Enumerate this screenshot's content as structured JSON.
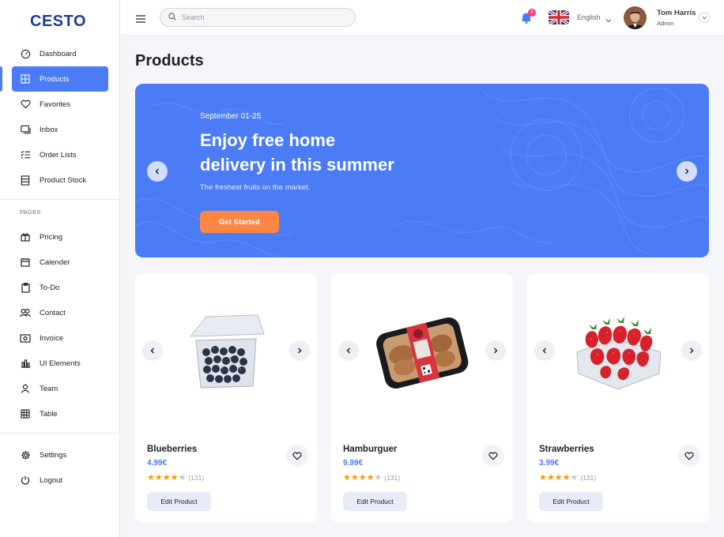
{
  "brand": {
    "logo": "CESTO"
  },
  "sidebar": {
    "items": [
      {
        "label": "Dashboard",
        "icon": "dashboard-icon"
      },
      {
        "label": "Products",
        "icon": "grid-icon",
        "active": true
      },
      {
        "label": "Favorites",
        "icon": "heart-icon"
      },
      {
        "label": "Inbox",
        "icon": "inbox-icon"
      },
      {
        "label": "Order Lists",
        "icon": "list-icon"
      },
      {
        "label": "Product Stock",
        "icon": "stock-icon"
      }
    ],
    "pages_label": "PAGES",
    "pages": [
      {
        "label": "Pricing",
        "icon": "gift-icon"
      },
      {
        "label": "Calender",
        "icon": "calendar-icon"
      },
      {
        "label": "To-Do",
        "icon": "clipboard-icon"
      },
      {
        "label": "Contact",
        "icon": "users-icon"
      },
      {
        "label": "Invoice",
        "icon": "invoice-icon"
      },
      {
        "label": "UI Elements",
        "icon": "bar-chart-icon"
      },
      {
        "label": "Team",
        "icon": "user-icon"
      },
      {
        "label": "Table",
        "icon": "table-icon"
      }
    ],
    "bottom": [
      {
        "label": "Settings",
        "icon": "gear-icon"
      },
      {
        "label": "Logout",
        "icon": "power-icon"
      }
    ]
  },
  "topbar": {
    "search_placeholder": "Search",
    "notifications_count": "6",
    "language": "English",
    "user_name": "Tom Harris",
    "user_role": "Admin"
  },
  "page": {
    "title": "Products"
  },
  "banner": {
    "date": "September 01-25",
    "headline_line1": "Enjoy free home",
    "headline_line2": "delivery in this summer",
    "subtitle": "The freshest fruits on the market.",
    "cta": "Get Started"
  },
  "products": [
    {
      "name": "Blueberries",
      "price": "4.99€",
      "rating": 4,
      "reviews": "(131)",
      "edit_label": "Edit Product"
    },
    {
      "name": "Hamburguer",
      "price": "9.99€",
      "rating": 4,
      "reviews": "(131)",
      "edit_label": "Edit Product"
    },
    {
      "name": "Strawberries",
      "price": "3.99€",
      "rating": 4,
      "reviews": "(131)",
      "edit_label": "Edit Product"
    }
  ],
  "colors": {
    "accent": "#4b7bf5",
    "cta": "#ff8743",
    "brand": "#1f3c99",
    "star": "#ff9500"
  }
}
